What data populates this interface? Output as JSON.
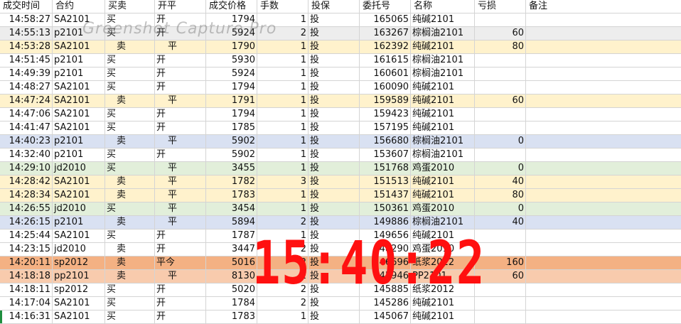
{
  "headers": [
    "成交时间",
    "合约",
    "买卖",
    "开平",
    "成交价格",
    "手数",
    "投保",
    "委托号",
    "名称",
    "亏损",
    "备注"
  ],
  "watermark": "Greenshot Capture Pro",
  "clock": "15:40:22",
  "rows": [
    {
      "time": "14:58:27",
      "code": "SA2101",
      "side": "买",
      "oc": "开",
      "price": "1794",
      "qty": "1",
      "hedge": "投",
      "order": "165065",
      "name": "纯碱2101",
      "pl": "",
      "note": "",
      "bg": "",
      "sell": false
    },
    {
      "time": "14:55:13",
      "code": "p2101",
      "side": "买",
      "oc": "开",
      "price": "5924",
      "qty": "2",
      "hedge": "投",
      "order": "163267",
      "name": "棕榈油2101",
      "pl": "60",
      "note": "",
      "bg": "gray",
      "sell": false
    },
    {
      "time": "14:53:28",
      "code": "SA2101",
      "side": "卖",
      "oc": "平",
      "price": "1790",
      "qty": "1",
      "hedge": "投",
      "order": "162392",
      "name": "纯碱2101",
      "pl": "80",
      "note": "",
      "bg": "yellow",
      "sell": true
    },
    {
      "time": "14:51:45",
      "code": "p2101",
      "side": "买",
      "oc": "开",
      "price": "5930",
      "qty": "1",
      "hedge": "投",
      "order": "161615",
      "name": "棕榈油2101",
      "pl": "",
      "note": "",
      "bg": "",
      "sell": false
    },
    {
      "time": "14:49:39",
      "code": "p2101",
      "side": "买",
      "oc": "开",
      "price": "5924",
      "qty": "1",
      "hedge": "投",
      "order": "160601",
      "name": "棕榈油2101",
      "pl": "",
      "note": "",
      "bg": "",
      "sell": false
    },
    {
      "time": "14:48:27",
      "code": "SA2101",
      "side": "买",
      "oc": "开",
      "price": "1794",
      "qty": "1",
      "hedge": "投",
      "order": "160090",
      "name": "纯碱2101",
      "pl": "",
      "note": "",
      "bg": "",
      "sell": false
    },
    {
      "time": "14:47:24",
      "code": "SA2101",
      "side": "卖",
      "oc": "平",
      "price": "1791",
      "qty": "1",
      "hedge": "投",
      "order": "159589",
      "name": "纯碱2101",
      "pl": "60",
      "note": "",
      "bg": "yellow",
      "sell": true
    },
    {
      "time": "14:47:06",
      "code": "SA2101",
      "side": "买",
      "oc": "开",
      "price": "1794",
      "qty": "1",
      "hedge": "投",
      "order": "159423",
      "name": "纯碱2101",
      "pl": "",
      "note": "",
      "bg": "",
      "sell": false
    },
    {
      "time": "14:41:47",
      "code": "SA2101",
      "side": "买",
      "oc": "开",
      "price": "1785",
      "qty": "1",
      "hedge": "投",
      "order": "157195",
      "name": "纯碱2101",
      "pl": "",
      "note": "",
      "bg": "",
      "sell": false
    },
    {
      "time": "14:40:23",
      "code": "p2101",
      "side": "卖",
      "oc": "平",
      "price": "5902",
      "qty": "1",
      "hedge": "投",
      "order": "156680",
      "name": "棕榈油2101",
      "pl": "0",
      "note": "",
      "bg": "blue",
      "sell": true
    },
    {
      "time": "14:32:40",
      "code": "p2101",
      "side": "买",
      "oc": "开",
      "price": "5902",
      "qty": "1",
      "hedge": "投",
      "order": "153607",
      "name": "棕榈油2101",
      "pl": "",
      "note": "",
      "bg": "",
      "sell": false
    },
    {
      "time": "14:29:10",
      "code": "jd2010",
      "side": "买",
      "oc": "平",
      "price": "3455",
      "qty": "1",
      "hedge": "投",
      "order": "151768",
      "name": "鸡蛋2010",
      "pl": "0",
      "note": "",
      "bg": "green",
      "sell": false,
      "ocIndent": true
    },
    {
      "time": "14:28:42",
      "code": "SA2101",
      "side": "卖",
      "oc": "平",
      "price": "1782",
      "qty": "3",
      "hedge": "投",
      "order": "151513",
      "name": "纯碱2101",
      "pl": "40",
      "note": "",
      "bg": "yellow",
      "sell": true
    },
    {
      "time": "14:28:34",
      "code": "SA2101",
      "side": "卖",
      "oc": "平",
      "price": "1783",
      "qty": "1",
      "hedge": "投",
      "order": "151437",
      "name": "纯碱2101",
      "pl": "80",
      "note": "",
      "bg": "yellow",
      "sell": true
    },
    {
      "time": "14:26:55",
      "code": "jd2010",
      "side": "买",
      "oc": "平",
      "price": "3454",
      "qty": "1",
      "hedge": "投",
      "order": "150361",
      "name": "鸡蛋2010",
      "pl": "0",
      "note": "",
      "bg": "green",
      "sell": false,
      "ocIndent": true
    },
    {
      "time": "14:26:15",
      "code": "p2101",
      "side": "卖",
      "oc": "平",
      "price": "5894",
      "qty": "2",
      "hedge": "投",
      "order": "149886",
      "name": "棕榈油2101",
      "pl": "40",
      "note": "",
      "bg": "blue",
      "sell": true
    },
    {
      "time": "14:25:44",
      "code": "SA2101",
      "side": "买",
      "oc": "开",
      "price": "1787",
      "qty": "1",
      "hedge": "投",
      "order": "149656",
      "name": "纯碱2101",
      "pl": "",
      "note": "",
      "bg": "",
      "sell": false
    },
    {
      "time": "14:23:15",
      "code": "jd2010",
      "side": "卖",
      "oc": "开",
      "price": "3447",
      "qty": "2",
      "hedge": "投",
      "order": "148290",
      "name": "鸡蛋2010",
      "pl": "",
      "note": "",
      "bg": "",
      "sell": true,
      "ocPlain": true
    },
    {
      "time": "14:20:11",
      "code": "sp2012",
      "side": "卖",
      "oc": "平今",
      "price": "5016",
      "qty": "2",
      "hedge": "投",
      "order": "146696",
      "name": "纸浆2012",
      "pl": "160",
      "note": "",
      "bg": "orange",
      "sell": true,
      "ocPlain": true
    },
    {
      "time": "14:18:18",
      "code": "pp2101",
      "side": "卖",
      "oc": "平",
      "price": "8130",
      "qty": "2",
      "hedge": "投",
      "order": "145946",
      "name": "PP2101",
      "pl": "60",
      "note": "",
      "bg": "peach",
      "sell": true
    },
    {
      "time": "14:18:11",
      "code": "sp2012",
      "side": "买",
      "oc": "开",
      "price": "5020",
      "qty": "2",
      "hedge": "投",
      "order": "145885",
      "name": "纸浆2012",
      "pl": "",
      "note": "",
      "bg": "",
      "sell": false
    },
    {
      "time": "14:17:04",
      "code": "SA2101",
      "side": "买",
      "oc": "开",
      "price": "1784",
      "qty": "2",
      "hedge": "投",
      "order": "145286",
      "name": "纯碱2101",
      "pl": "",
      "note": "",
      "bg": "",
      "sell": false
    },
    {
      "time": "14:16:31",
      "code": "SA2101",
      "side": "买",
      "oc": "开",
      "price": "1783",
      "qty": "1",
      "hedge": "投",
      "order": "145067",
      "name": "纯碱2101",
      "pl": "",
      "note": "",
      "bg": "",
      "sell": false
    }
  ]
}
